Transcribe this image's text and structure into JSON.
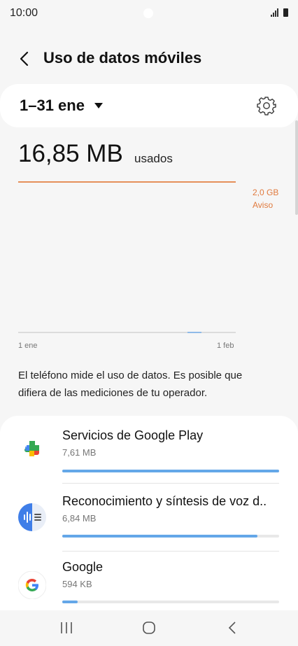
{
  "status_bar": {
    "time": "10:00"
  },
  "header": {
    "title": "Uso de datos móviles",
    "back_icon": "back-arrow-icon"
  },
  "period": {
    "range": "1–31 ene",
    "dropdown_icon": "caret-down-icon",
    "settings_icon": "gear-icon"
  },
  "usage": {
    "amount": "16,85 MB",
    "suffix": "usados"
  },
  "chart": {
    "warning_value": "2,0 GB",
    "warning_label": "Aviso",
    "x_start": "1 ene",
    "x_end": "1 feb",
    "colors": {
      "warning": "#e5905a",
      "usage": "#8fbbe8"
    }
  },
  "note": "El teléfono mide el uso de datos. Es posible que difiera de las mediciones de tu operador.",
  "apps": [
    {
      "name": "Servicios de Google Play",
      "size": "7,61 MB",
      "share": 1.0,
      "icon": "google-play-services-icon"
    },
    {
      "name": "Reconocimiento y síntesis de voz d..",
      "size": "6,84 MB",
      "share": 0.9,
      "icon": "speech-recognition-icon"
    },
    {
      "name": "Google",
      "size": "594 KB",
      "share": 0.07,
      "icon": "google-icon"
    }
  ],
  "accent_color": "#64a7e8"
}
